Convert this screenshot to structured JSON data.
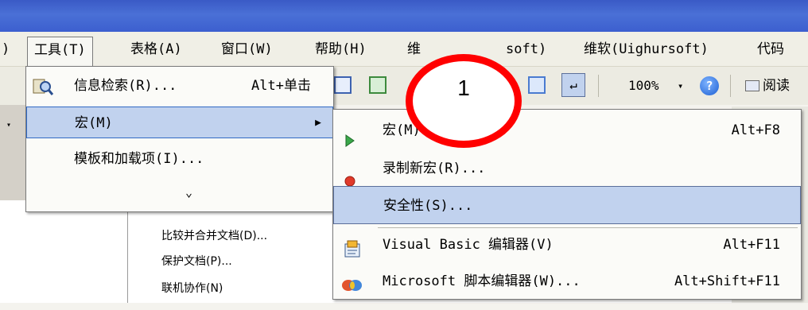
{
  "menubar": {
    "items": [
      {
        "label": ")",
        "name": "menu-fragment-left"
      },
      {
        "label": "工具(T)",
        "name": "menu-tools"
      },
      {
        "label": "表格(A)",
        "name": "menu-table"
      },
      {
        "label": "窗口(W)",
        "name": "menu-window"
      },
      {
        "label": "帮助(H)",
        "name": "menu-help"
      },
      {
        "label": "维",
        "name": "menu-weiruan-ms"
      },
      {
        "label": "soft)",
        "name": "menu-weiruan-ms-suffix"
      },
      {
        "label": "维软(Uighursoft)",
        "name": "menu-uighursoft"
      },
      {
        "label": "代码",
        "name": "menu-code"
      }
    ]
  },
  "toolbar": {
    "zoom": "100%",
    "zoom_arrow": "▾",
    "help_glyph": "?",
    "read_label": "阅读"
  },
  "tools_menu": {
    "items": [
      {
        "label": "信息检索(R)...",
        "shortcut": "Alt+单击",
        "icon": "research-icon"
      },
      {
        "label": "宏(M)",
        "shortcut": "",
        "submenu_arrow": "▶"
      },
      {
        "label": "模板和加载项(I)...",
        "shortcut": ""
      },
      {
        "label": "",
        "expand_glyph": "⌄"
      }
    ]
  },
  "macro_menu": {
    "items": [
      {
        "label": "宏(M)...",
        "shortcut": "Alt+F8",
        "icon": "play-macro-icon"
      },
      {
        "label": "录制新宏(R)...",
        "shortcut": "",
        "icon": "record-icon"
      },
      {
        "label": "安全性(S)...",
        "shortcut": "",
        "highlighted": true
      },
      {
        "label": "Visual Basic 编辑器(V)",
        "shortcut": "Alt+F11",
        "icon": "vb-editor-icon"
      },
      {
        "label": "Microsoft 脚本编辑器(W)...",
        "shortcut": "Alt+Shift+F11",
        "icon": "script-editor-icon"
      }
    ]
  },
  "background_menu": {
    "items": [
      {
        "label": "比较并合并文档(D)..."
      },
      {
        "label": "保护文档(P)..."
      },
      {
        "label": "联机协作(N)"
      }
    ]
  },
  "callout": {
    "number": "1",
    "color": "#ff0000"
  },
  "colors": {
    "highlight": "#c1d2ee",
    "titlebar": "#3c5fcf"
  }
}
